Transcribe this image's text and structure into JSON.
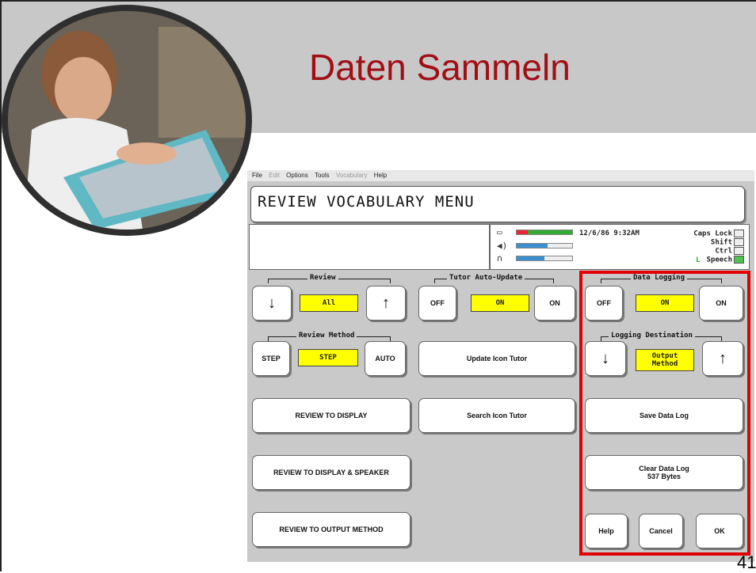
{
  "slide": {
    "title": "Daten Sammeln",
    "page_number": "41"
  },
  "menubar": {
    "items": [
      "File",
      "Edit",
      "Options",
      "Tools",
      "Vocabulary",
      "Help"
    ]
  },
  "screen_title": "REVIEW VOCABULARY MENU",
  "status": {
    "datetime": "12/6/86 9:32AM",
    "caps_lock": "Caps Lock",
    "shift": "Shift",
    "ctrl": "Ctrl",
    "speech_prefix": "L",
    "speech": "Speech"
  },
  "review": {
    "label": "Review",
    "down": "↓",
    "value": "All",
    "up": "↑"
  },
  "review_method": {
    "label": "Review Method",
    "step": "STEP",
    "value": "STEP",
    "auto": "AUTO"
  },
  "tutor": {
    "label": "Tutor Auto-Update",
    "off": "OFF",
    "value": "ON",
    "on": "ON",
    "update": "Update Icon Tutor",
    "search": "Search Icon Tutor"
  },
  "review_buttons": {
    "display": "REVIEW TO DISPLAY",
    "display_speaker": "REVIEW TO DISPLAY & SPEAKER",
    "output": "REVIEW TO OUTPUT METHOD"
  },
  "data_logging": {
    "label": "Data Logging",
    "off": "OFF",
    "value": "ON",
    "on": "ON"
  },
  "logging_destination": {
    "label": "Logging Destination",
    "down": "↓",
    "value": "Output\nMethod",
    "up": "↑"
  },
  "log_buttons": {
    "save": "Save Data Log",
    "clear": "Clear Data Log\n537 Bytes"
  },
  "footer_buttons": {
    "help": "Help",
    "cancel": "Cancel",
    "ok": "OK"
  },
  "colors": {
    "title_red": "#a00f16",
    "highlight_yellow": "#ffff00",
    "frame_red": "#e00000"
  }
}
